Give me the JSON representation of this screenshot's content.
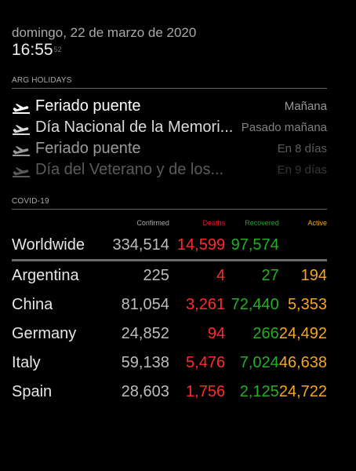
{
  "clock": {
    "date": "domingo, 22 de marzo de 2020",
    "time": "16:55",
    "seconds": "52"
  },
  "holidays_module": {
    "header": "ARG HOLIDAYS",
    "icon": "airplane-departure-icon",
    "items": [
      {
        "name": "Feriado puente",
        "when": "Mañana",
        "opacity": 1.0
      },
      {
        "name": "Día Nacional de la Memori...",
        "when": "Pasado mañana",
        "opacity": 0.85
      },
      {
        "name": "Feriado puente",
        "when": "En 8 días",
        "opacity": 0.6
      },
      {
        "name": "Día del Veterano y de los...",
        "when": "En 9 días",
        "opacity": 0.35
      }
    ]
  },
  "covid_module": {
    "header": "COVID-19",
    "columns": {
      "confirmed": "Confirmed",
      "deaths": "Deaths",
      "recovered": "Recovered",
      "active": "Active"
    },
    "colors": {
      "deaths": "#ff2a2a",
      "recovered": "#22b022",
      "active": "#f5a623"
    },
    "worldwide": {
      "country": "Worldwide",
      "confirmed": "334,514",
      "deaths": "14,599",
      "recovered": "97,574",
      "active": ""
    },
    "rows": [
      {
        "country": "Argentina",
        "confirmed": "225",
        "deaths": "4",
        "recovered": "27",
        "active": "194"
      },
      {
        "country": "China",
        "confirmed": "81,054",
        "deaths": "3,261",
        "recovered": "72,440",
        "active": "5,353"
      },
      {
        "country": "Germany",
        "confirmed": "24,852",
        "deaths": "94",
        "recovered": "266",
        "active": "24,492"
      },
      {
        "country": "Italy",
        "confirmed": "59,138",
        "deaths": "5,476",
        "recovered": "7,024",
        "active": "46,638"
      },
      {
        "country": "Spain",
        "confirmed": "28,603",
        "deaths": "1,756",
        "recovered": "2,125",
        "active": "24,722"
      }
    ]
  }
}
